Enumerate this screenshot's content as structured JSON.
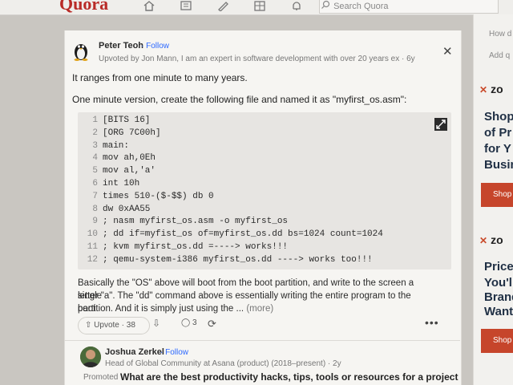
{
  "header": {
    "logo": "Quora",
    "search_placeholder": "Search Quora",
    "nav_icons": [
      "home-icon",
      "answer-icon",
      "pen-icon",
      "spaces-icon",
      "bell-icon"
    ]
  },
  "answer": {
    "author": "Peter Teoh",
    "follow": "Follow",
    "upvoted_line": "Upvoted by Jon Mann, I am an expert in software development with over 20 years ex · 6y",
    "intro": "It ranges from one minute to many years.",
    "instruction": "One minute version, create the following file and named it as \"myfirst_os.asm\":",
    "code": [
      {
        "n": "1",
        "text": "[BITS 16]"
      },
      {
        "n": "2",
        "text": "[ORG 7C00h]"
      },
      {
        "n": "3",
        "text": "main:"
      },
      {
        "n": "4",
        "text": "mov ah,0Eh"
      },
      {
        "n": "5",
        "text": "mov al,'a'"
      },
      {
        "n": "6",
        "text": "int 10h"
      },
      {
        "n": "7",
        "text": "times 510-($-$$) db 0"
      },
      {
        "n": "8",
        "text": "dw 0xAA55"
      },
      {
        "n": "9",
        "text": "; nasm myfirst_os.asm -o myfirst_os"
      },
      {
        "n": "10",
        "text": "; dd if=myfist_os of=myfirst_os.dd bs=1024 count=1024"
      },
      {
        "n": "11",
        "text": "; kvm myfirst_os.dd =----> works!!!"
      },
      {
        "n": "12",
        "text": "; qemu-system-i386 myfirst_os.dd ----> works too!!!"
      }
    ],
    "body_line1": "Basically the \"OS\" above will boot from the boot partition, and write to the screen a single",
    "body_line2": "letter \"a\". The \"dd\" command above is essentially writing the entire program to the boot",
    "body_line3": "partition. And it is simply just using the ...",
    "more": "(more)",
    "upvote_label": "Upvote",
    "upvote_count": "38",
    "comment_count": "3"
  },
  "next_answer": {
    "author": "Joshua Zerkel",
    "follow": "Follow",
    "credential": "Head of Global Community at Asana (product) (2018–present) · 2y",
    "promoted": "Promoted",
    "title": "What are the best productivity hacks, tips, tools or resources for a project"
  },
  "right_column": {
    "hint1": "How d",
    "hint2": "Add q",
    "ad1": {
      "brand": "zo",
      "lines": [
        "Shop",
        "of Pr",
        "for Y",
        "Busin"
      ],
      "button": "Shop"
    },
    "ad2": {
      "brand": "zo",
      "lines": [
        "Prices",
        "You'll",
        "Brands",
        "Want."
      ],
      "button": "Shop No"
    }
  }
}
